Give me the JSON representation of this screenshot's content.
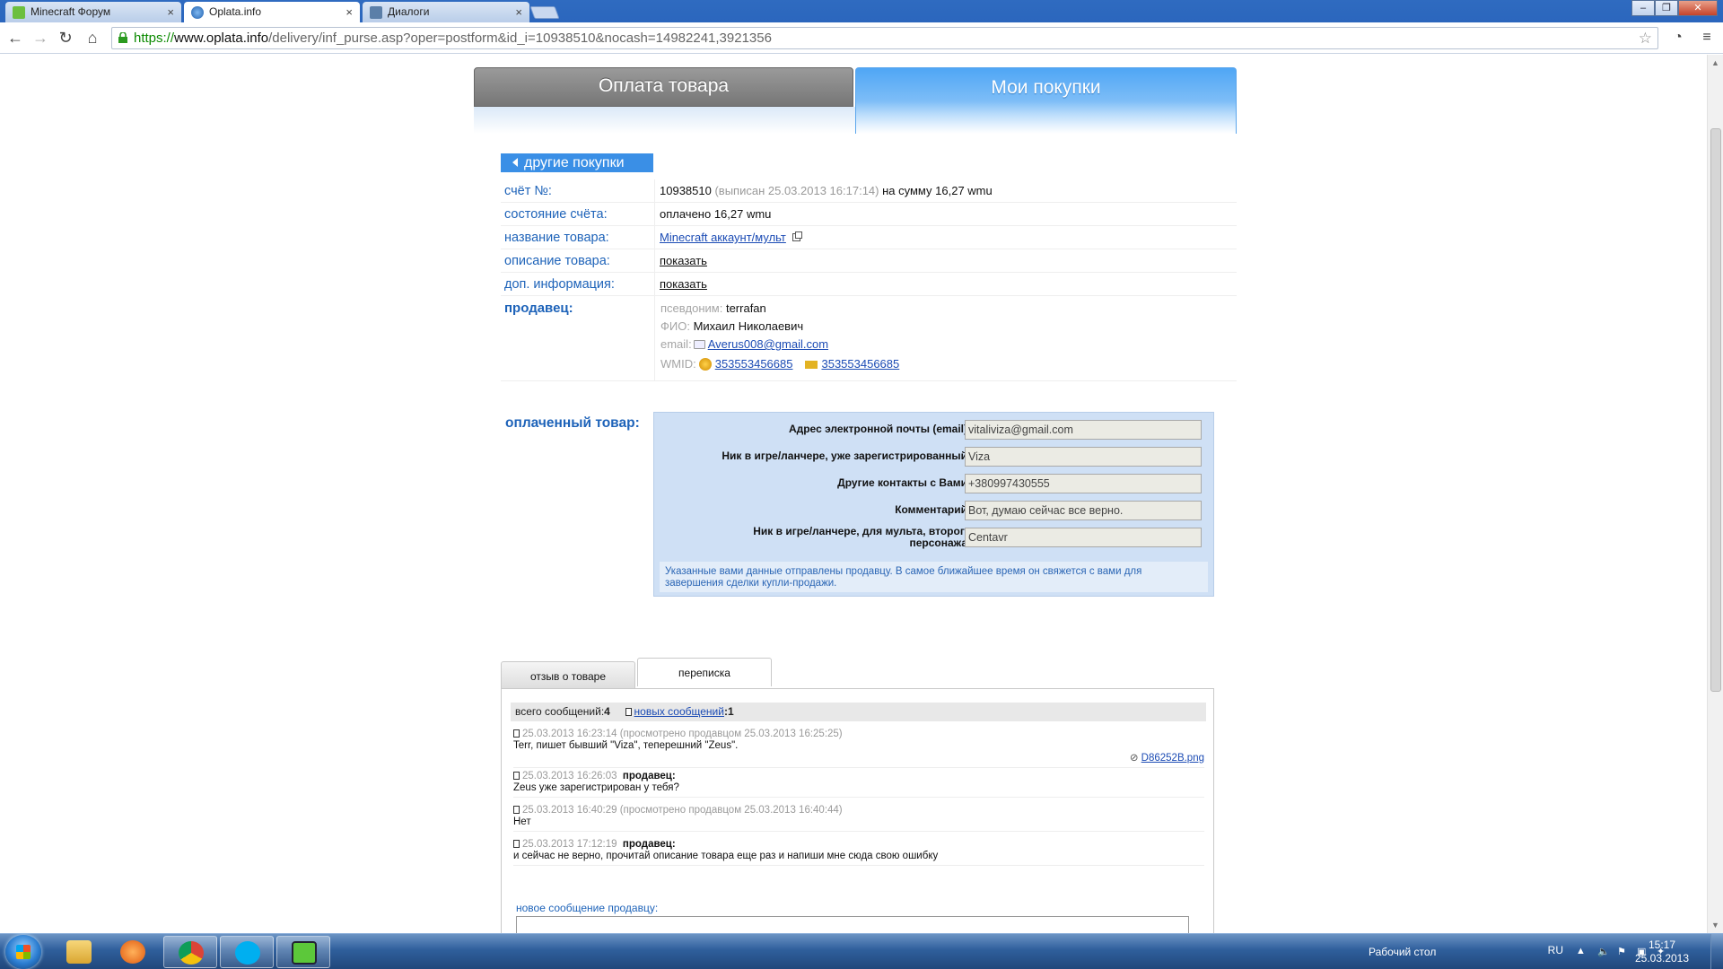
{
  "browser": {
    "tabs": [
      {
        "title": "Minecraft Форум",
        "close": "×"
      },
      {
        "title": "Oplata.info",
        "close": "×"
      },
      {
        "title": "Диалоги",
        "close": "×"
      }
    ],
    "url_scheme": "https://",
    "url_host": "www.oplata.info",
    "url_path": "/delivery/inf_purse.asp?oper=postform&id_i=10938510&nocash=14982241,3921356"
  },
  "page": {
    "tab_pay": "Оплата товара",
    "tab_mine": "Мои покупки",
    "back_button": "другие покупки",
    "invoice": {
      "label": "счёт №:",
      "number": "10938510",
      "issued": "(выписан 25.03.2013 16:17:14)",
      "sum_prefix": "на сумму",
      "sum": "16,27 wmu"
    },
    "status": {
      "label": "состояние счёта:",
      "value": "оплачено 16,27 wmu"
    },
    "product_name": {
      "label": "название товара:",
      "value": "Minecraft аккаунт/мульт"
    },
    "product_desc": {
      "label": "описание товара:",
      "value": "показать"
    },
    "extra_info": {
      "label": "доп. информация:",
      "value": "показать"
    },
    "seller": {
      "label": "продавец:",
      "nick_key": "псевдоним:",
      "nick": "terrafan",
      "fio_key": "ФИО:",
      "fio": "Михаил Николаевич",
      "email_key": "email:",
      "email": "Averus008@gmail.com",
      "wmid_key": "WMID:",
      "wmid1": "353553456685",
      "wmid2": "353553456685"
    },
    "paid": {
      "label": "оплаченный товар:",
      "fields": [
        {
          "label": "Адрес электронной почты (email):",
          "value": "vitaliviza@gmail.com"
        },
        {
          "label": "Ник в игре/ланчере, уже зарегистрированный:",
          "value": "Viza"
        },
        {
          "label": "Другие контакты с Вами:",
          "value": "+380997430555"
        },
        {
          "label": "Комментарий:",
          "value": "Вот, думаю сейчас все верно."
        },
        {
          "label": "Ник в игре/ланчере, для мульта, второго персонажа:",
          "value": "Centavr"
        }
      ],
      "notice": "Указанные вами данные отправлены продавцу. В самое ближайшее время он свяжется с вами для завершения сделки купли-продажи."
    },
    "bottom_tabs": {
      "review": "отзыв о товаре",
      "correspondence": "переписка"
    },
    "messages_bar": {
      "total_label": "всего сообщений:",
      "total": "4",
      "new_link": "новых сообщений",
      "new_count": ":1"
    },
    "messages": [
      {
        "meta": "25.03.2013 16:23:14  (просмотрено продавцом 25.03.2013 16:25:25)",
        "who": "",
        "body": "Terr, пишет бывший \"Viza\", теперешний \"Zeus\".",
        "attachment": "D86252B.png"
      },
      {
        "meta": "25.03.2013 16:26:03",
        "who": "продавец:",
        "body": "Zeus уже зарегистрирован у тебя?"
      },
      {
        "meta": "25.03.2013 16:40:29  (просмотрено продавцом 25.03.2013 16:40:44)",
        "who": "",
        "body": "Нет"
      },
      {
        "meta": "25.03.2013 17:12:19",
        "who": "продавец:",
        "body": "и сейчас не верно, прочитай описание товара еще раз и напиши мне сюда свою ошибку"
      }
    ],
    "new_message_label": "новое сообщение продавцу:"
  },
  "taskbar": {
    "desktop_label": "Рабочий стол",
    "lang": "RU",
    "time": "15:17",
    "date": "25.03.2013"
  }
}
